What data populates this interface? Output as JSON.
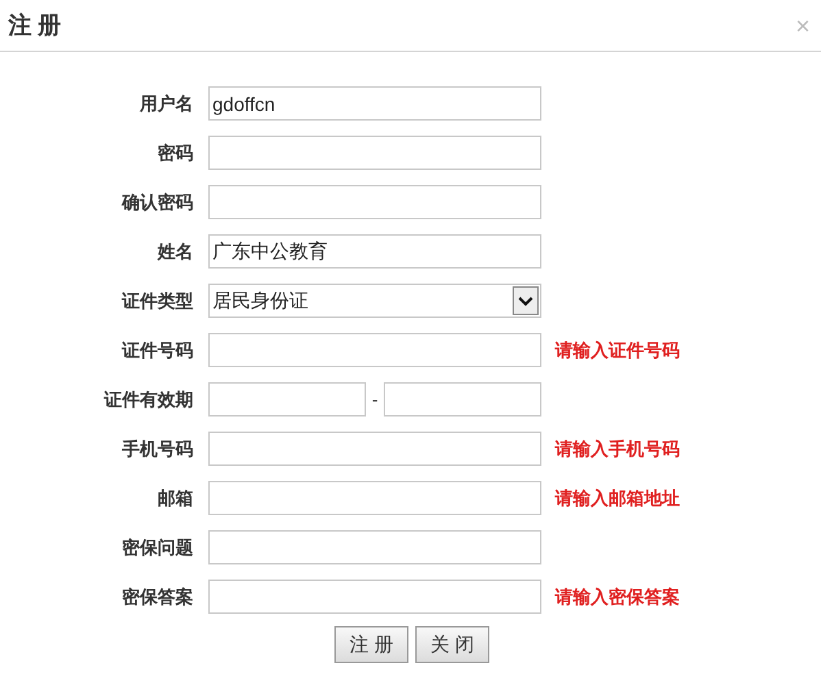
{
  "dialog": {
    "title": "注 册",
    "close": "×"
  },
  "fields": [
    {
      "kind": "text",
      "label": "用户名",
      "value": "gdoffcn"
    },
    {
      "kind": "text",
      "label": "密码"
    },
    {
      "kind": "text",
      "label": "确认密码"
    },
    {
      "kind": "text",
      "label": "姓名",
      "value": "广东中公教育"
    },
    {
      "kind": "select",
      "label": "证件类型",
      "value": "居民身份证"
    },
    {
      "kind": "text",
      "label": "证件号码",
      "error": "请输入证件号码"
    },
    {
      "kind": "range",
      "label": "证件有效期",
      "separator": "-"
    },
    {
      "kind": "text",
      "label": "手机号码",
      "error": "请输入手机号码"
    },
    {
      "kind": "text",
      "label": "邮箱",
      "error": "请输入邮箱地址"
    },
    {
      "kind": "text",
      "label": "密保问题"
    },
    {
      "kind": "text",
      "label": "密保答案",
      "error": "请输入密保答案"
    }
  ],
  "buttons": [
    "注 册",
    "关 闭"
  ]
}
